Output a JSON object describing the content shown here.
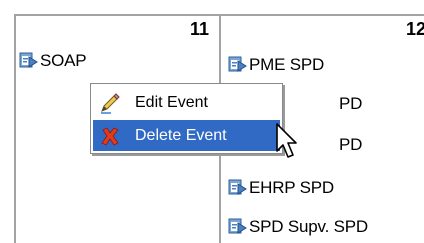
{
  "calendar": {
    "days": [
      {
        "number": "11",
        "events": [
          "SOAP"
        ]
      },
      {
        "number": "12",
        "events": [
          "PME SPD",
          "PD",
          "PD",
          "EHRP SPD",
          "SPD Supv. SPD"
        ]
      }
    ]
  },
  "context_menu": {
    "items": [
      {
        "label": "Edit Event",
        "icon": "pencil-icon",
        "selected": false
      },
      {
        "label": "Delete Event",
        "icon": "red-x-icon",
        "selected": true
      }
    ],
    "highlight_color": "#316ac5"
  },
  "event_icon": "event-doc-icon"
}
